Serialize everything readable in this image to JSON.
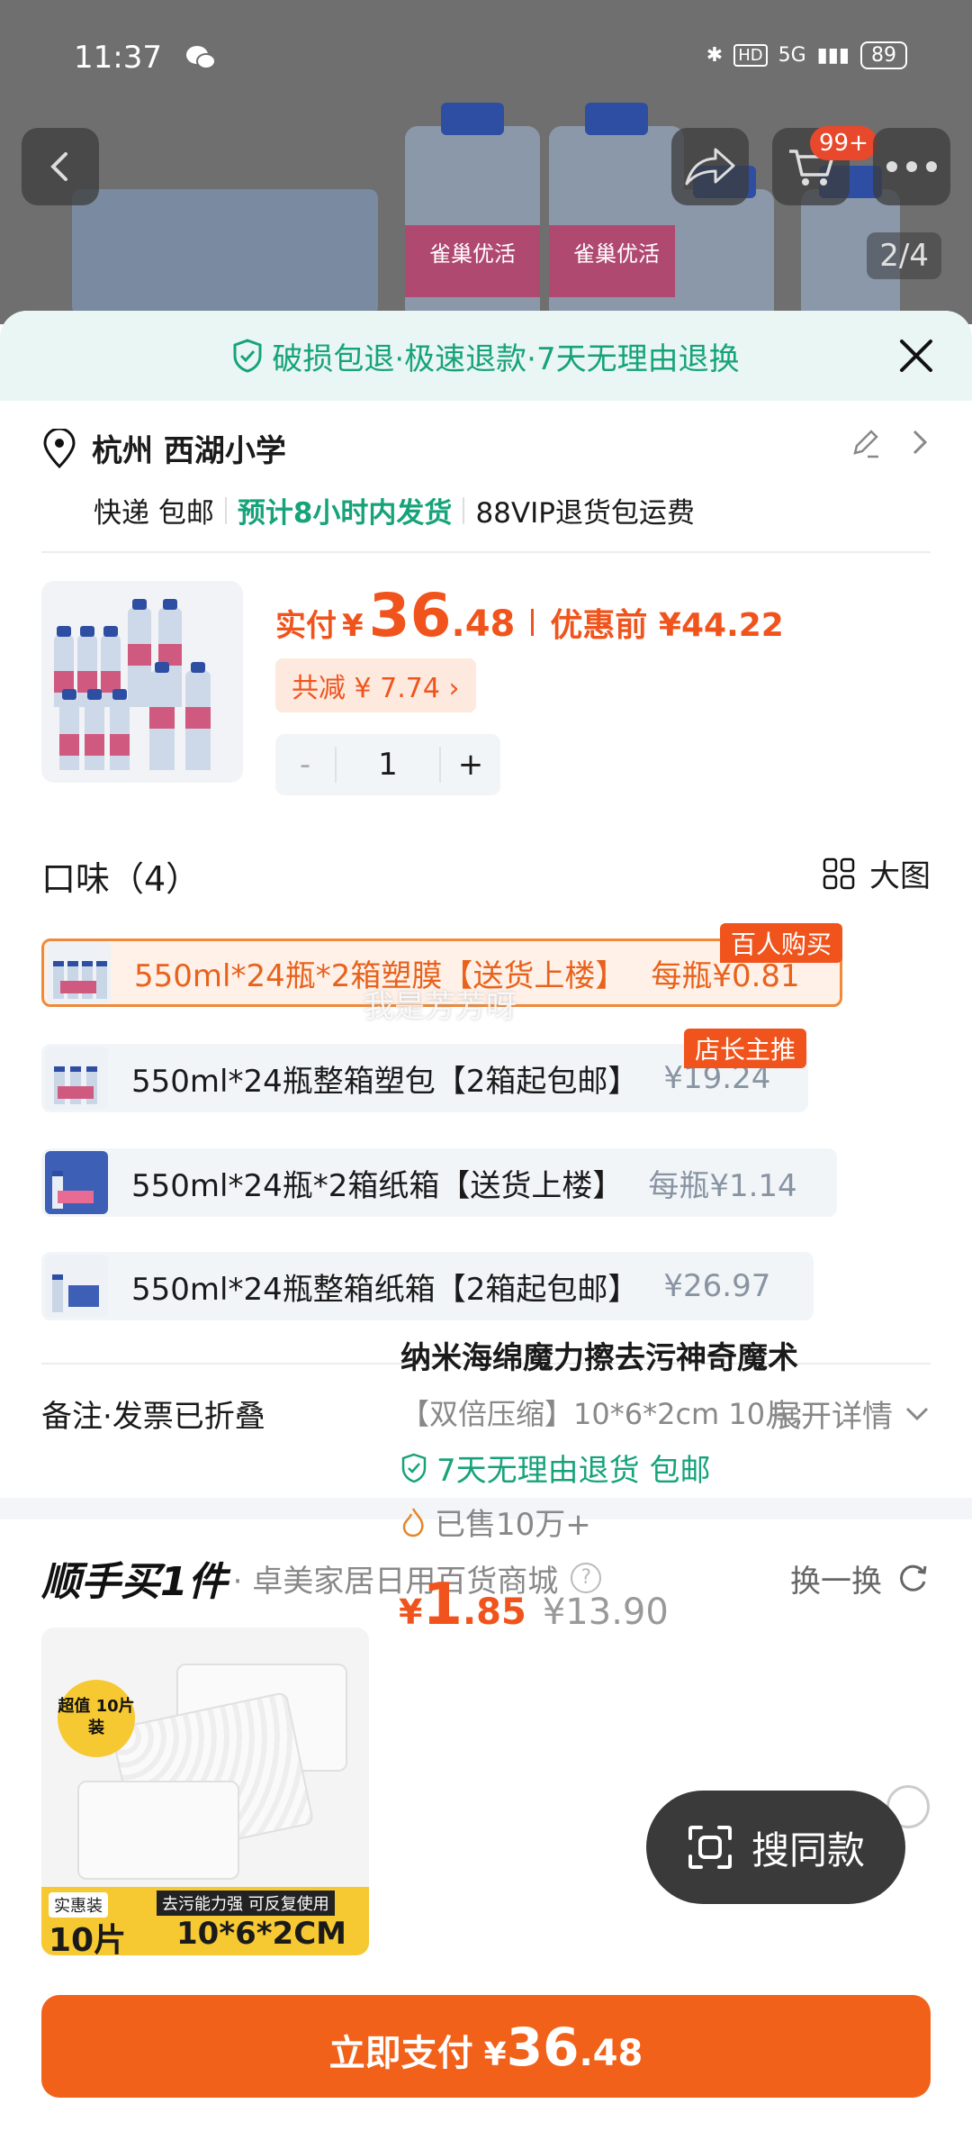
{
  "status_bar": {
    "time": "11:37",
    "network": "5G",
    "battery": "89"
  },
  "top": {
    "cart_badge": "99+",
    "image_pager": "2/4",
    "bottle_label": "雀巢优活"
  },
  "banner": {
    "text": "破损包退·极速退款·7天无理由退换"
  },
  "address": {
    "location": "杭州 西湖小学",
    "delivery": "快递 包邮",
    "ship_time": "预计8小时内发货",
    "vip": "88VIP退货包运费"
  },
  "product": {
    "price_label": "实付",
    "yen": "¥",
    "price_int": "36",
    "price_dec": ".48",
    "orig_label": "优惠前 ¥44.22",
    "saving": "共减 ¥ 7.74 ›",
    "quantity": "1",
    "minus": "-",
    "plus": "+"
  },
  "flavor": {
    "heading": "口味（4）",
    "big_view": "大图",
    "options": [
      {
        "name": "550ml*24瓶*2箱塑膜【送货上楼】",
        "price": "每瓶¥0.81",
        "tag": "百人购买",
        "selected": true
      },
      {
        "name": "550ml*24瓶整箱塑包【2箱起包邮】",
        "price": "¥19.24",
        "tag": "店长主推",
        "selected": false
      },
      {
        "name": "550ml*24瓶*2箱纸箱【送货上楼】",
        "price": "每瓶¥1.14",
        "tag": "",
        "selected": false
      },
      {
        "name": "550ml*24瓶整箱纸箱【2箱起包邮】",
        "price": "¥26.97",
        "tag": "",
        "selected": false
      }
    ]
  },
  "watermark": "我是芳芳呀",
  "remark": {
    "text": "备注·发票已折叠",
    "expand": "展开详情"
  },
  "addon": {
    "brand": "顺手买1件",
    "shop": "· 卓美家居日用百货商城",
    "help": "?",
    "swap": "换一换",
    "title": "纳米海绵魔力擦去污神奇魔术",
    "spec": "【双倍压缩】10*6*2cm 10片;",
    "return": "7天无理由退货  包邮",
    "sold": "已售10万+",
    "yen": "¥",
    "price_int": "1",
    "price_dec": ".85",
    "orig": "¥13.90",
    "img_sticker": "超值 10片装",
    "img_a": "实惠装",
    "img_b": "10片",
    "img_c": "去污能力强  可反复使用",
    "img_d": "10*6*2CM"
  },
  "search_same": "搜同款",
  "pay": {
    "label": "立即支付",
    "yen": "¥",
    "int": "36",
    "dec": ".48"
  },
  "colors": {
    "accent": "#f0541c",
    "green": "#17a37a",
    "pay": "#f2611a"
  }
}
